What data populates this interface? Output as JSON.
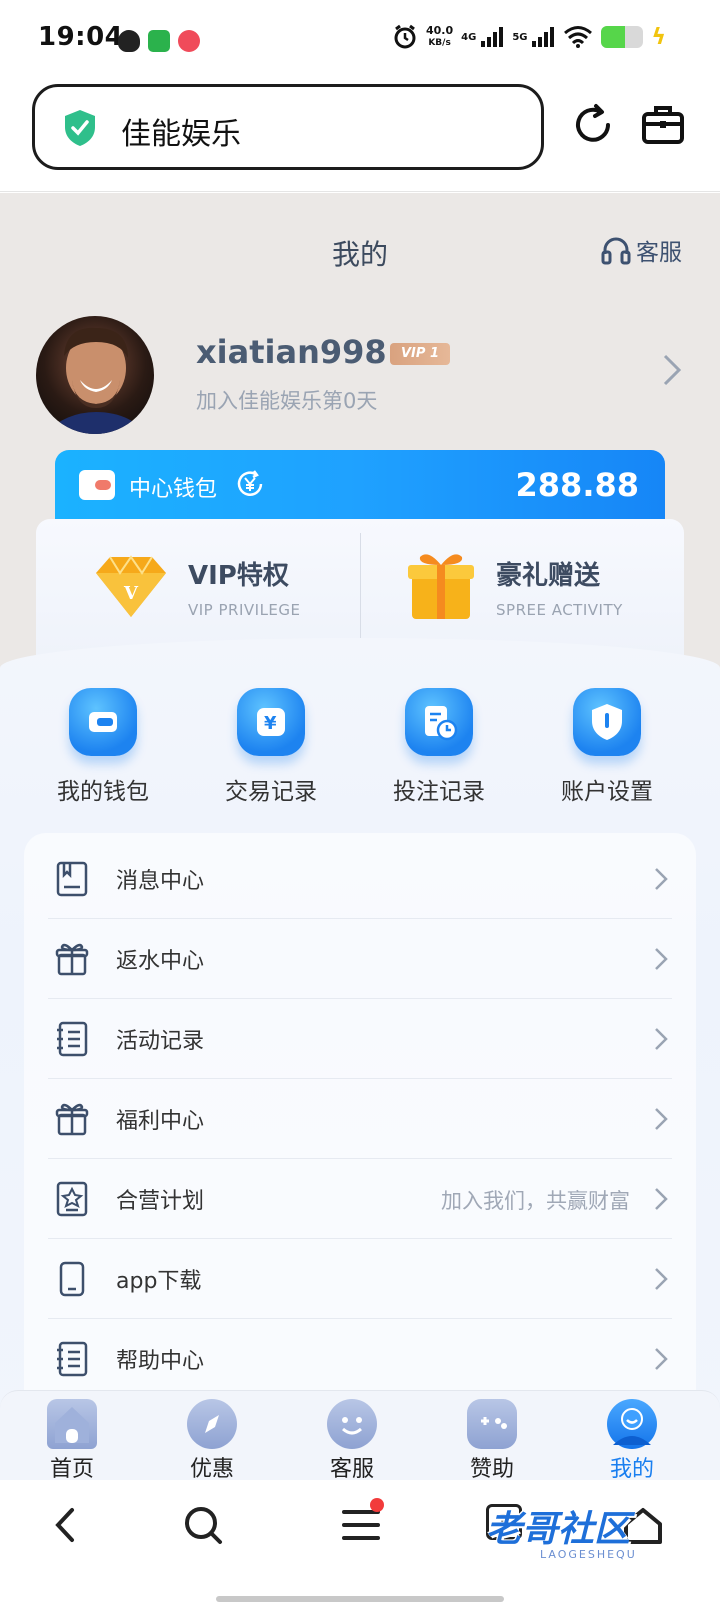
{
  "status_bar": {
    "time": "19:04",
    "net_speed_value": "40.0",
    "net_speed_unit": "KB/s",
    "signal_1": "4G",
    "signal_2": "5G",
    "battery_level": 0.55
  },
  "browser": {
    "url_title": "佳能娱乐"
  },
  "page": {
    "title": "我的",
    "service_label": "客服"
  },
  "profile": {
    "username": "xiatian998",
    "vip_badge": "VIP 1",
    "join_text": "加入佳能娱乐第0天"
  },
  "wallet": {
    "label": "中心钱包",
    "amount": "288.88"
  },
  "privileges": [
    {
      "title": "VIP特权",
      "subtitle": "VIP PRIVILEGE",
      "icon": "diamond-icon"
    },
    {
      "title": "豪礼赠送",
      "subtitle": "SPREE ACTIVITY",
      "icon": "gift-box-icon"
    }
  ],
  "quick_actions": [
    {
      "label": "我的钱包",
      "icon": "wallet-icon"
    },
    {
      "label": "交易记录",
      "icon": "yen-icon"
    },
    {
      "label": "投注记录",
      "icon": "bet-record-icon"
    },
    {
      "label": "账户设置",
      "icon": "shield-icon"
    }
  ],
  "menu": [
    {
      "label": "消息中心",
      "hint": "",
      "icon": "message-icon"
    },
    {
      "label": "返水中心",
      "hint": "",
      "icon": "gift-icon"
    },
    {
      "label": "活动记录",
      "hint": "",
      "icon": "list-icon"
    },
    {
      "label": "福利中心",
      "hint": "",
      "icon": "gift-icon"
    },
    {
      "label": "合营计划",
      "hint": "加入我们，共赢财富",
      "icon": "star-card-icon"
    },
    {
      "label": "app下载",
      "hint": "",
      "icon": "phone-icon"
    },
    {
      "label": "帮助中心",
      "hint": "",
      "icon": "list-icon"
    }
  ],
  "tabs": [
    {
      "label": "首页",
      "icon": "home-icon",
      "active": false
    },
    {
      "label": "优惠",
      "icon": "compass-icon",
      "active": false
    },
    {
      "label": "客服",
      "icon": "smile-icon",
      "active": false
    },
    {
      "label": "赞助",
      "icon": "gamepad-icon",
      "active": false
    },
    {
      "label": "我的",
      "icon": "user-icon",
      "active": true
    }
  ],
  "browser_nav": {
    "tab_count": "3",
    "watermark": "老哥社区",
    "watermark_sub": "LAOGESHEQU"
  },
  "colors": {
    "accent_blue": "#1a7ff0",
    "wallet_gradient_start": "#1bb2ff",
    "page_bg": "#ebe8e6"
  }
}
